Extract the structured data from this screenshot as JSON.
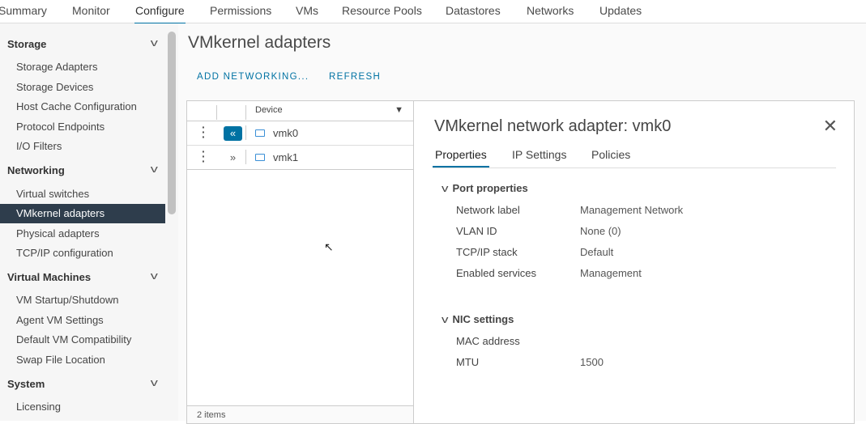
{
  "topnav": {
    "tabs": [
      "Summary",
      "Monitor",
      "Configure",
      "Permissions",
      "VMs",
      "Resource Pools",
      "Datastores",
      "Networks",
      "Updates"
    ],
    "active": "Configure"
  },
  "sidebar": {
    "sections": [
      {
        "label": "Storage",
        "items": [
          "Storage Adapters",
          "Storage Devices",
          "Host Cache Configuration",
          "Protocol Endpoints",
          "I/O Filters"
        ]
      },
      {
        "label": "Networking",
        "items": [
          "Virtual switches",
          "VMkernel adapters",
          "Physical adapters",
          "TCP/IP configuration"
        ]
      },
      {
        "label": "Virtual Machines",
        "items": [
          "VM Startup/Shutdown",
          "Agent VM Settings",
          "Default VM Compatibility",
          "Swap File Location"
        ]
      },
      {
        "label": "System",
        "items": [
          "Licensing"
        ]
      }
    ],
    "selected": "VMkernel adapters"
  },
  "main": {
    "title": "VMkernel adapters",
    "add_networking": "ADD NETWORKING...",
    "refresh": "REFRESH"
  },
  "grid": {
    "column": "Device",
    "rows": [
      "vmk0",
      "vmk1"
    ],
    "footer": "2 items"
  },
  "detail": {
    "title": "VMkernel network adapter: vmk0",
    "tabs": [
      "Properties",
      "IP Settings",
      "Policies"
    ],
    "port_properties": {
      "heading": "Port properties",
      "rows": [
        {
          "label": "Network label",
          "value": "Management Network"
        },
        {
          "label": "VLAN ID",
          "value": "None (0)"
        },
        {
          "label": "TCP/IP stack",
          "value": "Default"
        },
        {
          "label": "Enabled services",
          "value": "Management"
        }
      ]
    },
    "nic_settings": {
      "heading": "NIC settings",
      "rows": [
        {
          "label": "MAC address",
          "value": ""
        },
        {
          "label": "MTU",
          "value": "1500"
        }
      ]
    }
  },
  "colors": {
    "accent": "#0072a3",
    "selected_bg": "#2e3d4c"
  }
}
